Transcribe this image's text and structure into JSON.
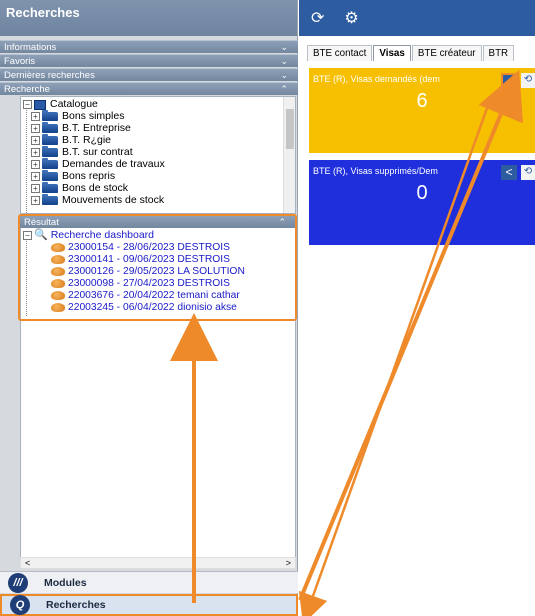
{
  "left": {
    "title": "Recherches",
    "sections": {
      "informations": "Informations",
      "favoris": "Favoris",
      "dernieres": "Dernières recherches",
      "recherche": "Recherche",
      "resultat": "Résultat"
    },
    "catalogue": {
      "root": "Catalogue",
      "items": [
        "Bons simples",
        "B.T. Entreprise",
        "B.T. R¿gie",
        "B.T. sur contrat",
        "Demandes de travaux",
        "Bons repris",
        "Bons de stock",
        "Mouvements de stock"
      ]
    },
    "results": {
      "root": "Recherche dashboard",
      "items": [
        "23000154 - 28/06/2023 DESTROIS",
        "23000141 - 09/06/2023 DESTROIS",
        "23000126 - 29/05/2023 LA SOLUTION",
        "23000098 - 27/04/2023 DESTROIS",
        "22003676 - 20/04/2022 temani cathar",
        "22003245 - 06/04/2022 dionisio akse"
      ]
    },
    "bottom": {
      "modules": "Modules",
      "recherches": "Recherches"
    }
  },
  "right": {
    "tabs": [
      "BTE contact",
      "Visas",
      "BTE créateur",
      "BTR"
    ],
    "active_tab": "Visas",
    "tiles": [
      {
        "title": "BTE (R), Visas demandés (dem",
        "value": "6",
        "color": "#f6c000"
      },
      {
        "title": "BTE (R), Visas supprimés/Dem",
        "value": "0",
        "color": "#1f2fdc"
      }
    ]
  },
  "colors": {
    "accent": "#2d5ca1",
    "highlight": "#ee8a2a"
  }
}
